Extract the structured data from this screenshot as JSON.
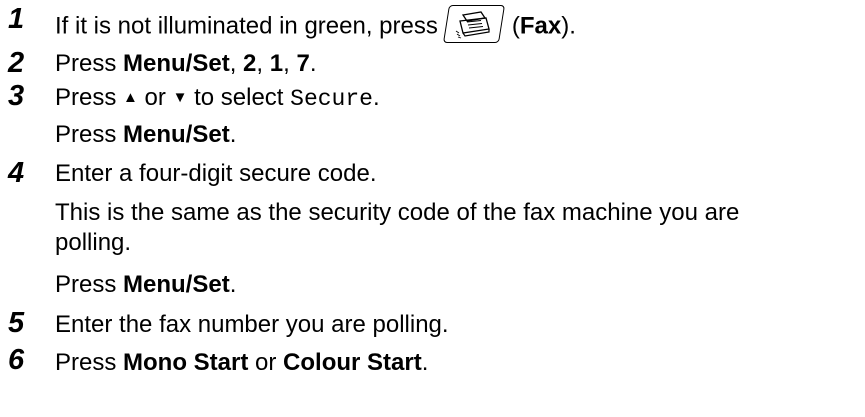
{
  "steps": [
    {
      "num": "1",
      "line1_pre": "If it is not illuminated in green, press",
      "line1_paren_open": "(",
      "line1_bold": "Fax",
      "line1_paren_close": ").",
      "key_icon": "fax-machine-icon"
    },
    {
      "num": "2",
      "pre": "Press ",
      "bold1": "Menu/Set",
      "sep1": ", ",
      "bold2": "2",
      "sep2": ", ",
      "bold3": "1",
      "sep3": ", ",
      "bold4": "7",
      "end": "."
    },
    {
      "num": "3",
      "pre": "Press ",
      "up": "▲",
      "mid": " or ",
      "down": "▼",
      "post": " to select ",
      "mono": "Secure",
      "end": ".",
      "line2_pre": "Press ",
      "line2_bold": "Menu/Set",
      "line2_end": "."
    },
    {
      "num": "4",
      "text": "Enter a four-digit secure code.",
      "note_line1": "This is the same as the security code of the fax machine you are",
      "note_line2": "polling.",
      "line3_pre": "Press ",
      "line3_bold": "Menu/Set",
      "line3_end": "."
    },
    {
      "num": "5",
      "text": "Enter the fax number you are polling."
    },
    {
      "num": "6",
      "pre": "Press ",
      "bold1": "Mono Start",
      "mid": " or ",
      "bold2": "Colour Start",
      "end": "."
    }
  ]
}
